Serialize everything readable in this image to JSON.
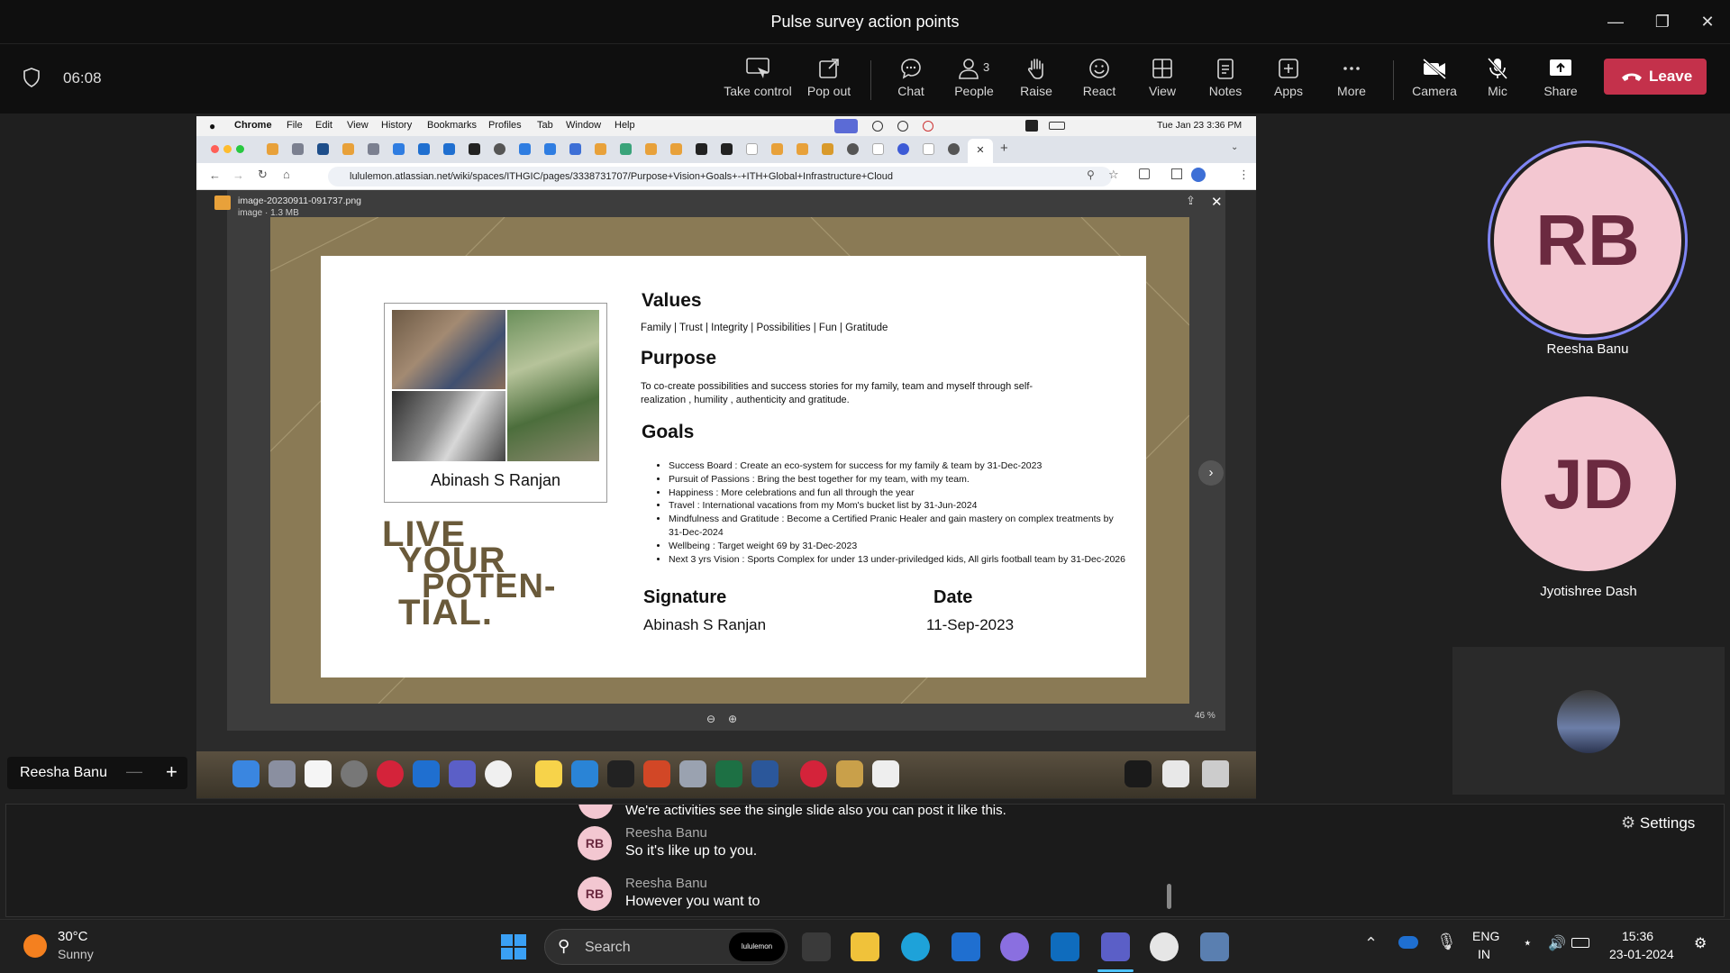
{
  "window": {
    "title": "Pulse survey action points"
  },
  "toolbar": {
    "timer": "06:08",
    "buttons": [
      {
        "label": "Take control"
      },
      {
        "label": "Pop out"
      },
      {
        "label": "Chat"
      },
      {
        "label": "People",
        "badge": "3"
      },
      {
        "label": "Raise"
      },
      {
        "label": "React"
      },
      {
        "label": "View"
      },
      {
        "label": "Notes"
      },
      {
        "label": "Apps"
      },
      {
        "label": "More"
      },
      {
        "label": "Camera"
      },
      {
        "label": "Mic"
      },
      {
        "label": "Share"
      }
    ],
    "leave_label": "Leave"
  },
  "shared_screen": {
    "mac_menu": [
      "Chrome",
      "File",
      "Edit",
      "View",
      "History",
      "Bookmarks",
      "Profiles",
      "Tab",
      "Window",
      "Help"
    ],
    "mac_clock": "Tue Jan 23  3:36 PM",
    "url": "lululemon.atlassian.net/wiki/spaces/ITHGIC/pages/3338731707/Purpose+Vision+Goals+-+ITH+Global+Infrastructure+Cloud",
    "file_name": "image-20230911-091737.png",
    "file_meta": "image · 1.3 MB",
    "zoom": "46 %",
    "slide": {
      "photo_caption": "Abinash S Ranjan",
      "live_text": [
        "LIVE",
        "YOUR",
        "POTEN-",
        "TIAL."
      ],
      "values_heading": "Values",
      "values_text": "Family | Trust | Integrity | Possibilities | Fun | Gratitude",
      "purpose_heading": "Purpose",
      "purpose_text": "To co-create possibilities and success stories for my family, team and myself through self-realization , humility , authenticity and gratitude.",
      "goals_heading": "Goals",
      "goals": [
        "Success Board :  Create an eco-system for success for my family & team by 31-Dec-2023",
        "Pursuit of Passions : Bring the best together for my team, with my team.",
        "Happiness : More celebrations and fun all through the year",
        "Travel : International vacations from my Mom's bucket list by 31-Jun-2024",
        "Mindfulness and Gratitude : Become a Certified Pranic Healer and gain mastery on complex treatments by 31-Dec-2024",
        "Wellbeing : Target weight 69 by 31-Dec-2023",
        "Next 3 yrs Vision : Sports Complex for under 13 under-priviledged kids, All girls football team by 31-Dec-2026"
      ],
      "signature_heading": "Signature",
      "signature_value": "Abinash S Ranjan",
      "date_heading": "Date",
      "date_value": "11-Sep-2023"
    }
  },
  "self_view": {
    "name": "Reesha Banu"
  },
  "participants": [
    {
      "initials": "RB",
      "name": "Reesha Banu"
    },
    {
      "initials": "JD",
      "name": "Jyotishree Dash"
    }
  ],
  "chat": {
    "partial_message": "We're activities see the single slide also you can post it like this.",
    "messages": [
      {
        "initials": "RB",
        "sender": "Reesha Banu",
        "text": "So it's like up to you."
      },
      {
        "initials": "RB",
        "sender": "Reesha Banu",
        "text": "However you want to"
      }
    ],
    "settings_label": "Settings"
  },
  "taskbar": {
    "weather_temp": "30°C",
    "weather_desc": "Sunny",
    "search_placeholder": "Search",
    "pinned_app": "lululemon",
    "lang_top": "ENG",
    "lang_bottom": "IN",
    "time": "15:36",
    "date": "23-01-2024"
  }
}
